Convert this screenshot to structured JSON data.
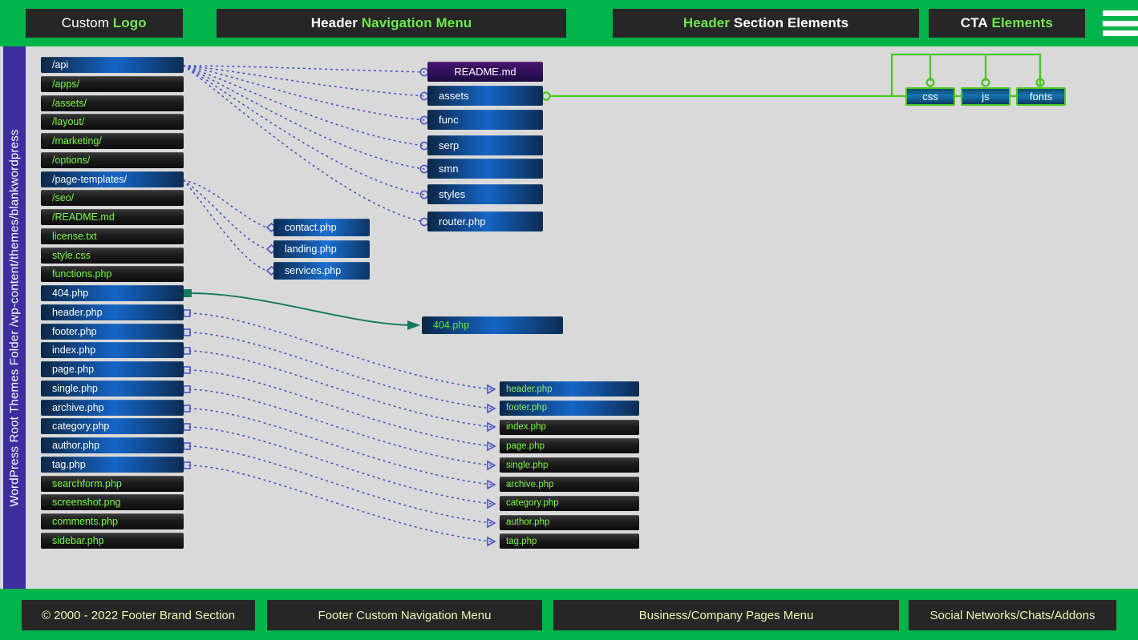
{
  "header": {
    "logo": {
      "plain": "Custom",
      "accent": "Logo"
    },
    "nav": {
      "accent_first": false,
      "plain": "Header",
      "accent": "Navigation Menu"
    },
    "section": {
      "accent": "Header",
      "plain": "Section Elements"
    },
    "cta": {
      "plain": "CTA",
      "accent": "Elements"
    },
    "menu_icon": "hamburger-icon"
  },
  "rail": {
    "label": "WordPress Root Themes Folder  /wp-content/themes/blankwordpress"
  },
  "filelist": [
    {
      "label": "/api",
      "style": "blue"
    },
    {
      "label": "/apps/",
      "style": "dark"
    },
    {
      "label": "/assets/",
      "style": "dark"
    },
    {
      "label": "/layout/",
      "style": "dark"
    },
    {
      "label": "/marketing/",
      "style": "dark"
    },
    {
      "label": "/options/",
      "style": "dark"
    },
    {
      "label": "/page-templates/",
      "style": "blue"
    },
    {
      "label": "/seo/",
      "style": "dark"
    },
    {
      "label": "/README.md",
      "style": "dark"
    },
    {
      "label": "license.txt",
      "style": "dark"
    },
    {
      "label": "style.css",
      "style": "dark"
    },
    {
      "label": "functions.php",
      "style": "dark"
    },
    {
      "label": "404.php",
      "style": "blue"
    },
    {
      "label": "header.php",
      "style": "blue"
    },
    {
      "label": "footer.php",
      "style": "blue"
    },
    {
      "label": "index.php",
      "style": "blue"
    },
    {
      "label": "page.php",
      "style": "blue"
    },
    {
      "label": "single.php",
      "style": "blue"
    },
    {
      "label": "archive.php",
      "style": "blue"
    },
    {
      "label": "category.php",
      "style": "blue"
    },
    {
      "label": "author.php",
      "style": "blue"
    },
    {
      "label": "tag.php",
      "style": "blue"
    },
    {
      "label": "searchform.php",
      "style": "dark"
    },
    {
      "label": "screenshot.png",
      "style": "dark"
    },
    {
      "label": "comments.php",
      "style": "dark"
    },
    {
      "label": "sidebar.php",
      "style": "dark"
    }
  ],
  "api_children": [
    {
      "label": "README.md",
      "style": "purple"
    },
    {
      "label": "assets",
      "style": "blue"
    },
    {
      "label": "func",
      "style": "blue"
    },
    {
      "label": "serp",
      "style": "blue"
    },
    {
      "label": "smn",
      "style": "blue"
    },
    {
      "label": "styles",
      "style": "blue"
    },
    {
      "label": "router.php",
      "style": "blue"
    }
  ],
  "page_templates": [
    {
      "label": "contact.php"
    },
    {
      "label": "landing.php"
    },
    {
      "label": "services.php"
    }
  ],
  "error_target": {
    "label": "404.php"
  },
  "templates": [
    {
      "label": "header.php",
      "style": "blue"
    },
    {
      "label": "footer.php",
      "style": "blue"
    },
    {
      "label": "index.php",
      "style": "dark"
    },
    {
      "label": "page.php",
      "style": "dark"
    },
    {
      "label": "single.php",
      "style": "dark"
    },
    {
      "label": "archive.php",
      "style": "dark"
    },
    {
      "label": "category.php",
      "style": "dark"
    },
    {
      "label": "author.php",
      "style": "dark"
    },
    {
      "label": "tag.php",
      "style": "dark"
    }
  ],
  "asset_folders": [
    {
      "label": "css"
    },
    {
      "label": "js"
    },
    {
      "label": "fonts"
    }
  ],
  "footer": {
    "brand": "© 2000 - 2022 Footer Brand Section",
    "nav": "Footer Custom Navigation Menu",
    "business": "Business/Company Pages Menu",
    "social": "Social Networks/Chats/Addons"
  },
  "colors": {
    "brand_green": "#00b44a",
    "accent_green": "#6ee84f",
    "panel_dark": "#262626",
    "rail_purple": "#3b2f9e",
    "canvas": "#d9d9d9",
    "wire_blue": "#4a56c8",
    "wire_green": "#49c71e",
    "wire_teal": "#14795f"
  }
}
